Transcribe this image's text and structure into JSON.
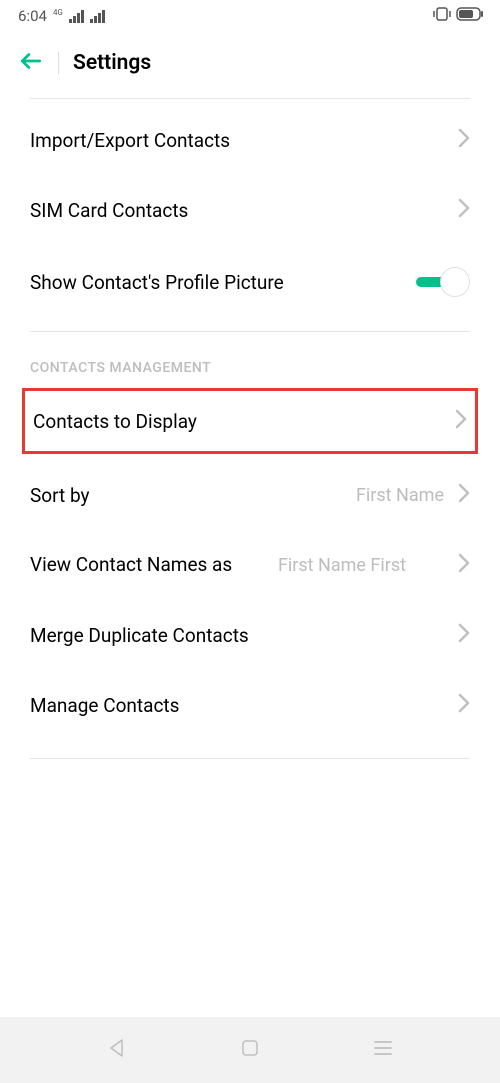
{
  "statusBar": {
    "time": "6:04",
    "networkLabel": "4G"
  },
  "header": {
    "title": "Settings"
  },
  "rows": {
    "importExport": "Import/Export Contacts",
    "simCard": "SIM Card Contacts",
    "profilePicture": "Show Contact's Profile Picture",
    "profilePictureToggle": true
  },
  "sectionHeader": "CONTACTS MANAGEMENT",
  "management": {
    "contactsToDisplay": "Contacts to Display",
    "sortBy": "Sort by",
    "sortByValue": "First Name",
    "viewNames": "View Contact Names as",
    "viewNamesValue": "First Name First",
    "mergeDuplicate": "Merge Duplicate Contacts",
    "manageContacts": "Manage Contacts"
  }
}
